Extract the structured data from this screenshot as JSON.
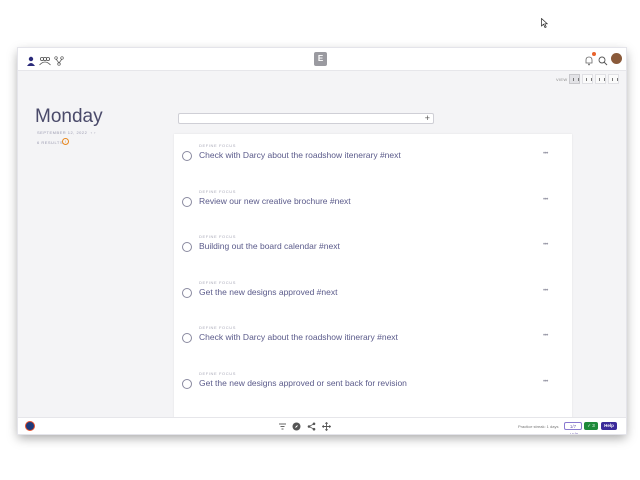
{
  "topbar": {
    "logo_letter": "E",
    "left_icons": [
      "user-icon",
      "team-icon",
      "network-icon"
    ],
    "right_icons": [
      "bell-icon",
      "search-icon",
      "avatar"
    ],
    "accent_color": "#e8622c"
  },
  "view": {
    "label": "VIEW",
    "options": [
      "list-view",
      "columns-view",
      "grid-view",
      "calendar-view"
    ],
    "active": "list-view"
  },
  "header": {
    "day": "Monday",
    "date": "SEPTEMBER 12, 2022",
    "results": "6 RESULTS",
    "results_badge": "!"
  },
  "addbar": {
    "placeholder": "",
    "plus": "+"
  },
  "tasks": [
    {
      "category": "DEFINE FOCUS",
      "title": "Check with Darcy about the roadshow itenerary #next",
      "more": "•••"
    },
    {
      "category": "DEFINE FOCUS",
      "title": "Review our new creative brochure #next",
      "more": "•••"
    },
    {
      "category": "DEFINE FOCUS",
      "title": "Building out the board calendar #next",
      "more": "•••"
    },
    {
      "category": "DEFINE FOCUS",
      "title": "Get the new designs approved #next",
      "more": "•••"
    },
    {
      "category": "DEFINE FOCUS",
      "title": "Check with Darcy about the roadshow itinerary #next",
      "more": "•••"
    },
    {
      "category": "DEFINE FOCUS",
      "title": "Get the new designs approved or sent back for revision",
      "more": "•••"
    }
  ],
  "bottombar": {
    "icons": [
      "filter-icon",
      "compass-icon",
      "share-icon",
      "move-icon"
    ],
    "status": "Practice streak: 1 days",
    "pill_outline": "1/7 ✓1/2",
    "pill_green": "✓ 3",
    "help": "Help"
  }
}
